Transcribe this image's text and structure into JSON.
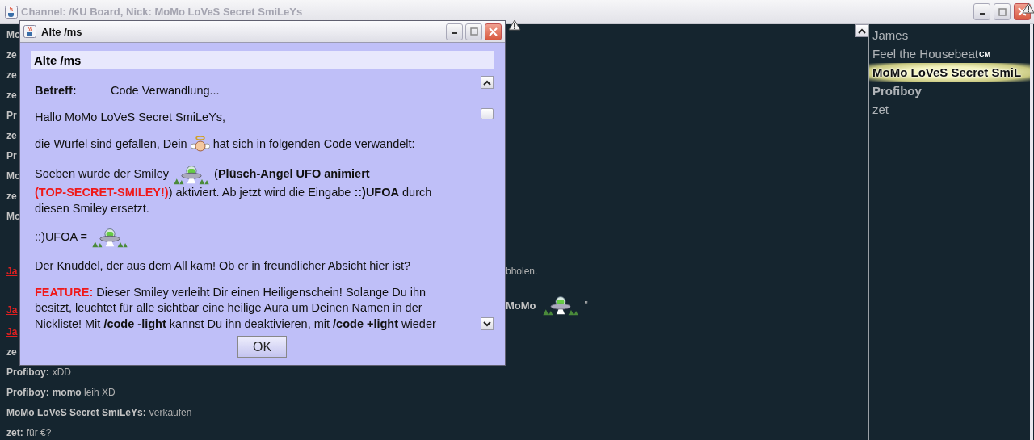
{
  "window": {
    "title": "Channel: /KU Board,  Nick: MoMo LoVeS Secret SmiLeYs"
  },
  "chat": {
    "lines": [
      {
        "nick": "Mo",
        "kind": "plain"
      },
      {
        "nick": "ze",
        "kind": "plain"
      },
      {
        "nick": "ze",
        "kind": "plain"
      },
      {
        "nick": "ze",
        "kind": "plain"
      },
      {
        "nick": "Pr",
        "kind": "plain"
      },
      {
        "nick": "ze",
        "kind": "plain"
      },
      {
        "nick": "Pr",
        "kind": "plain"
      },
      {
        "nick": "Mo",
        "kind": "plain"
      },
      {
        "nick": "ze",
        "kind": "plain"
      },
      {
        "nick": "Mo",
        "kind": "plain"
      },
      {
        "nick": "Ja",
        "kind": "link",
        "tail": "bholen."
      },
      {
        "nick": "Ja",
        "kind": "link",
        "tail": "**MoMo**",
        "tail_smiley": true,
        "tail_after": "\""
      },
      {
        "nick": "Ja",
        "kind": "link"
      },
      {
        "nick": "ze",
        "kind": "plain"
      },
      {
        "nick": "Profiboy:",
        "kind": "plain",
        "text": "xDD"
      },
      {
        "nick": "Profiboy:",
        "kind": "plain",
        "text": "**momo** leih XD"
      },
      {
        "nick": "MoMo LoVeS Secret SmiLeYs:",
        "kind": "plain",
        "text": "verkaufen"
      },
      {
        "nick": "zet:",
        "kind": "plain",
        "text": "für €?"
      }
    ]
  },
  "nicklist": [
    {
      "name": "James",
      "kind": "plain"
    },
    {
      "name": "Feel the Housebeat",
      "kind": "plain",
      "badge": "CM"
    },
    {
      "name": "MoMo LoVeS Secret SmiL",
      "kind": "glow"
    },
    {
      "name": "Profiboy",
      "kind": "bold"
    },
    {
      "name": "zet",
      "kind": "plain"
    }
  ],
  "dialog": {
    "title": "Alte /ms",
    "header": "Alte /ms",
    "subject_label": "Betreff:",
    "subject": "Code Verwandlung...",
    "paragraphs": [
      [
        {
          "kind": "text",
          "text": "Hallo MoMo LoVeS Secret SmiLeYs,"
        }
      ],
      [
        {
          "kind": "text",
          "text": "die Würfel sind gefallen, Dein "
        },
        {
          "kind": "angel"
        },
        {
          "kind": "text",
          "text": " hat sich in folgenden Code verwandelt:"
        }
      ],
      [
        {
          "kind": "text",
          "text": "Soeben wurde der Smiley "
        },
        {
          "kind": "ufo"
        },
        {
          "kind": "text",
          "text": " ("
        },
        {
          "kind": "bold",
          "text": "Plüsch-Angel UFO animiert"
        },
        {
          "kind": "alert",
          "text": "(TOP-SECRET-SMILEY!)"
        },
        {
          "kind": "text",
          "text": ") aktiviert. Ab jetzt wird die Eingabe "
        },
        {
          "kind": "bold",
          "text": "::)UFOA"
        },
        {
          "kind": "text",
          "text": " durch diesen Smiley ersetzt."
        }
      ],
      [
        {
          "kind": "text",
          "text": "::)UFOA = "
        },
        {
          "kind": "ufo"
        }
      ],
      [
        {
          "kind": "text",
          "text": "Der Knuddel, der aus dem All kam! Ob er in freundlicher Absicht hier ist?"
        }
      ],
      [
        {
          "kind": "alert",
          "text": "FEATURE:"
        },
        {
          "kind": "text",
          "text": " Dieser Smiley verleiht Dir einen Heiligenschein! Solange Du ihn besitzt, leuchtet für alle sichtbar eine heilige Aura um Deinen Namen in der Nickliste! Mit "
        },
        {
          "kind": "bold",
          "text": "/code -light"
        },
        {
          "kind": "text",
          "text": " kannst Du ihn deaktivieren, mit "
        },
        {
          "kind": "bold",
          "text": "/code +light"
        },
        {
          "kind": "text",
          "text": " wieder"
        }
      ]
    ],
    "ok": "OK"
  }
}
